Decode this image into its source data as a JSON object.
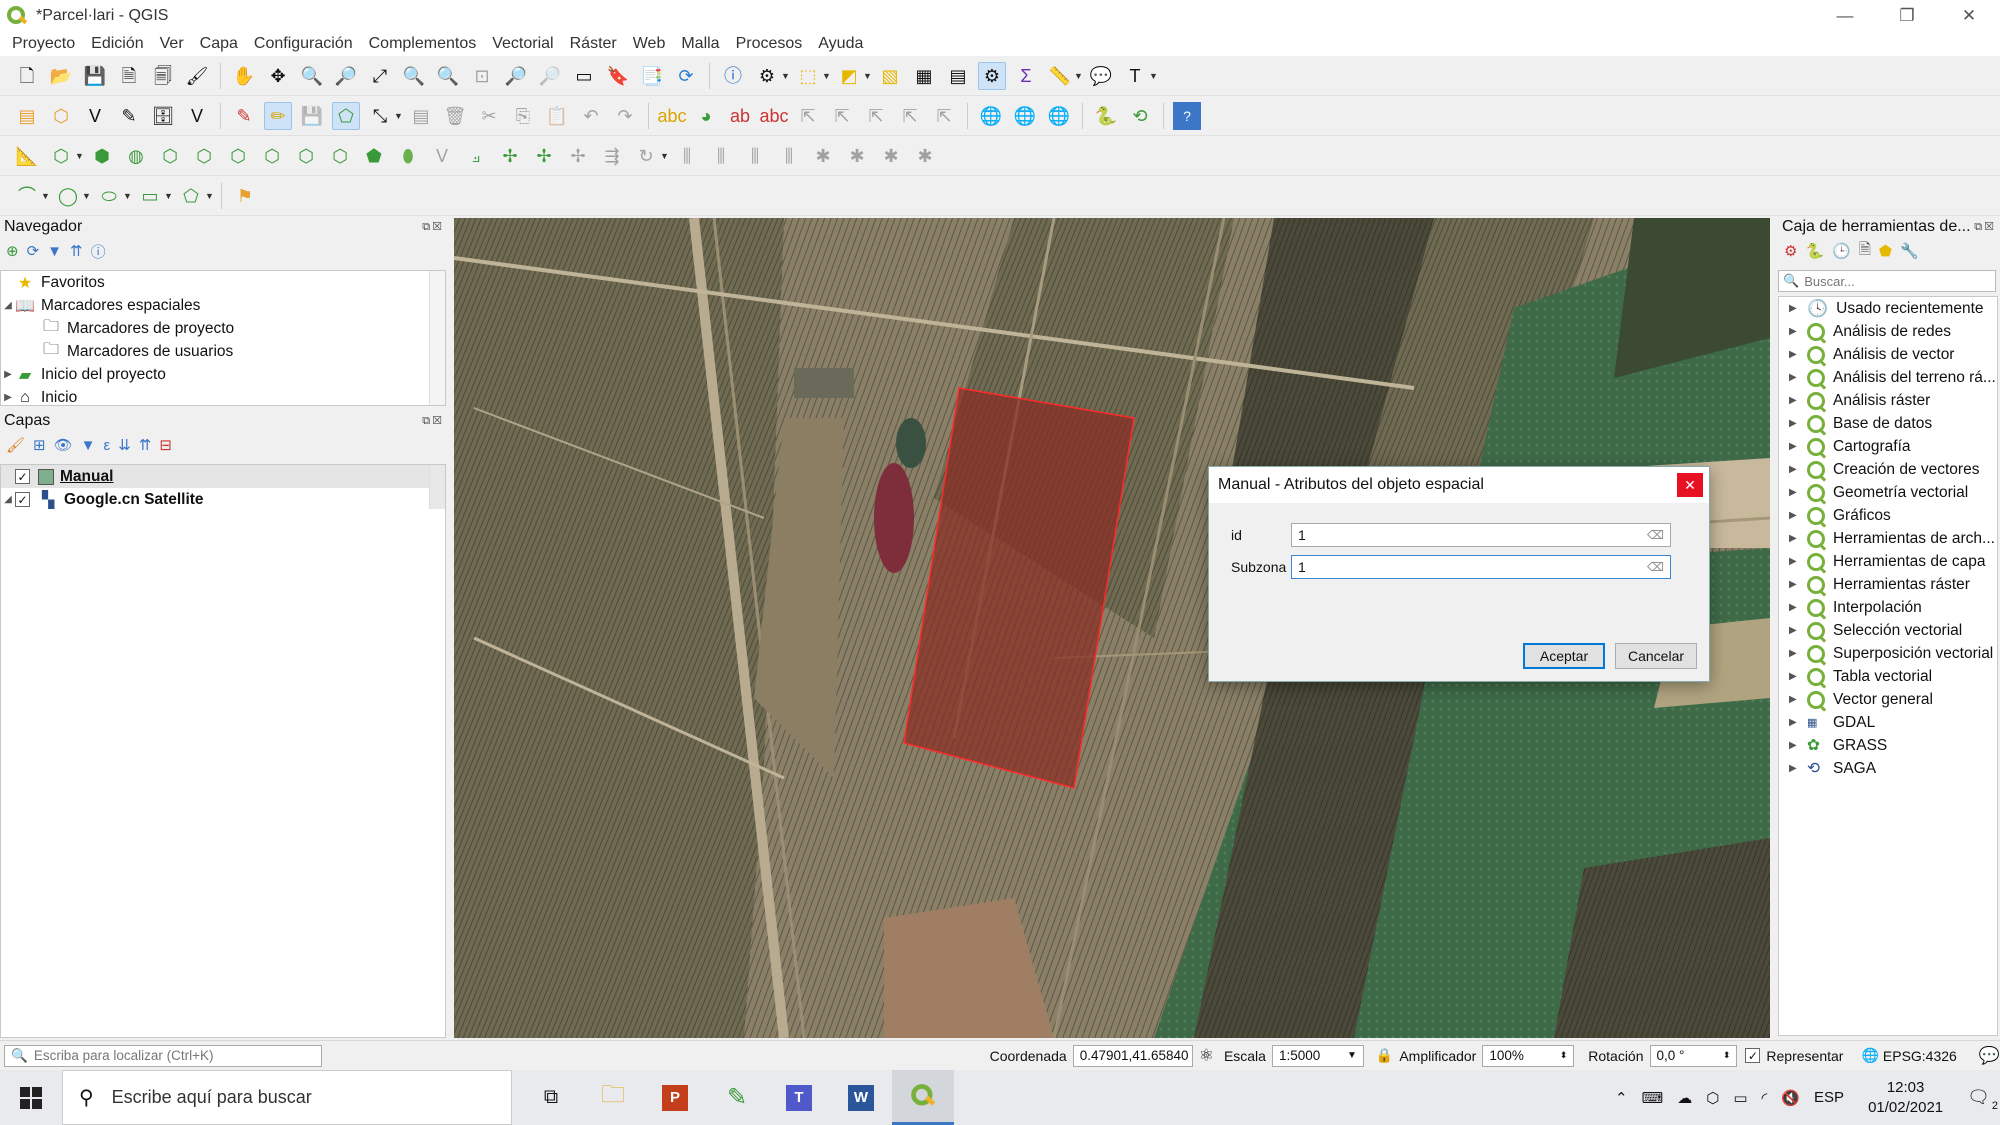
{
  "window": {
    "title": "*Parcel·lari - QGIS",
    "minimize": "—",
    "restore": "❐",
    "close": "✕"
  },
  "menu": [
    {
      "label": "Proyecto"
    },
    {
      "label": "Edición"
    },
    {
      "label": "Ver"
    },
    {
      "label": "Capa"
    },
    {
      "label": "Configuración"
    },
    {
      "label": "Complementos"
    },
    {
      "label": "Vectorial"
    },
    {
      "label": "Ráster"
    },
    {
      "label": "Web"
    },
    {
      "label": "Malla"
    },
    {
      "label": "Procesos"
    },
    {
      "label": "Ayuda"
    }
  ],
  "navigator": {
    "title": "Navegador",
    "items": [
      {
        "label": "Favoritos",
        "icon": "star-icon"
      },
      {
        "label": "Marcadores espaciales",
        "icon": "book-icon"
      },
      {
        "label": "Marcadores de proyecto",
        "icon": "folder-icon"
      },
      {
        "label": "Marcadores de usuarios",
        "icon": "folder-icon"
      },
      {
        "label": "Inicio del proyecto",
        "icon": "project-folder-icon"
      },
      {
        "label": "Inicio",
        "icon": "home-icon"
      }
    ]
  },
  "layers": {
    "title": "Capas",
    "items": [
      {
        "label": "Manual",
        "checked": true,
        "icon": "polygon-layer-icon"
      },
      {
        "label": "Google.cn Satellite",
        "checked": true,
        "icon": "raster-layer-icon"
      }
    ]
  },
  "toolbox": {
    "title": "Caja de herramientas de...",
    "search_placeholder": "Buscar...",
    "items": [
      {
        "label": "Usado recientemente"
      },
      {
        "label": "Análisis de redes"
      },
      {
        "label": "Análisis de vector"
      },
      {
        "label": "Análisis del terreno rá..."
      },
      {
        "label": "Análisis ráster"
      },
      {
        "label": "Base de datos"
      },
      {
        "label": "Cartografía"
      },
      {
        "label": "Creación de vectores"
      },
      {
        "label": "Geometría vectorial"
      },
      {
        "label": "Gráficos"
      },
      {
        "label": "Herramientas de arch..."
      },
      {
        "label": "Herramientas de capa"
      },
      {
        "label": "Herramientas ráster"
      },
      {
        "label": "Interpolación"
      },
      {
        "label": "Selección vectorial"
      },
      {
        "label": "Superposición vectorial"
      },
      {
        "label": "Tabla vectorial"
      },
      {
        "label": "Vector general"
      },
      {
        "label": "GDAL"
      },
      {
        "label": "GRASS"
      },
      {
        "label": "SAGA"
      }
    ]
  },
  "dialog": {
    "title": "Manual - Atributos del objeto espacial",
    "fields": [
      {
        "label": "id",
        "value": "1"
      },
      {
        "label": "Subzona",
        "value": "1"
      }
    ],
    "ok_label": "Aceptar",
    "cancel_label": "Cancelar"
  },
  "statusbar": {
    "locate_placeholder": "Escriba para localizar (Ctrl+K)",
    "coord_label": "Coordenada",
    "coord_value": "0.47901,41.65840",
    "scale_label": "Escala",
    "scale_value": "1:5000",
    "magnifier_label": "Amplificador",
    "magnifier_value": "100%",
    "rotation_label": "Rotación",
    "rotation_value": "0,0 °",
    "render_label": "Representar",
    "crs": "EPSG:4326"
  },
  "taskbar": {
    "search_placeholder": "Escribe aquí para buscar",
    "lang": "ESP",
    "time": "12:03",
    "date": "01/02/2021",
    "notif_count": "2"
  }
}
